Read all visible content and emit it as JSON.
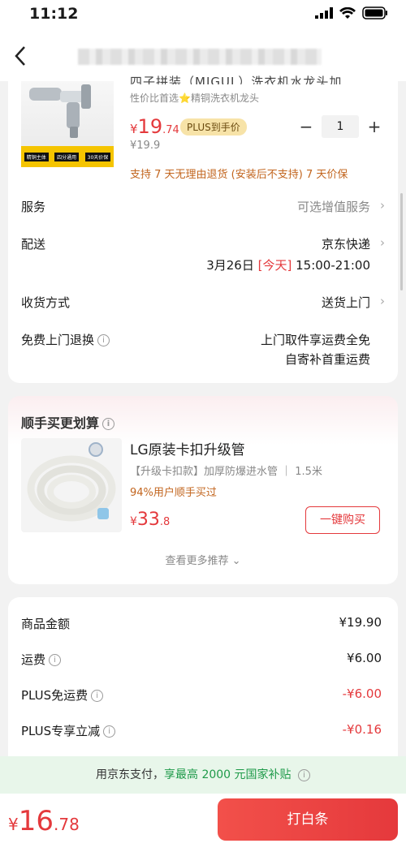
{
  "status": {
    "time": "11:12"
  },
  "product": {
    "name_cut": "四子拼装（MIGUL）洗衣机水龙头加…",
    "subtitle": "性价比首选⭐精铜洗衣机龙头",
    "price_yen": "¥",
    "price_int": "19",
    "price_dec": ".74",
    "plus_badge": "PLUS到手价",
    "orig_price": "¥19.9",
    "quantity": "1",
    "minus": "−",
    "plus": "+",
    "return_policy": "支持 7 天无理由退货 (安装后不支持)  7 天价保",
    "image_tags": [
      "精铜主体",
      "四分通用",
      "30天价保"
    ]
  },
  "service": {
    "label": "服务",
    "value": "可选增值服务"
  },
  "delivery": {
    "label": "配送",
    "carrier": "京东快递",
    "date": "3月26日",
    "today": "[今天]",
    "time": "15:00-21:00"
  },
  "receive": {
    "label": "收货方式",
    "value": "送货上门"
  },
  "free_return": {
    "label": "免费上门退换",
    "line1": "上门取件享运费全免",
    "line2": "自寄补首重运费"
  },
  "recommend": {
    "title": "顺手买更划算",
    "name": "LG原装卡扣升级管",
    "spec": "【升级卡扣款】加厚防爆进水管  ｜ 1.5米",
    "stat": "94%用户顺手买过",
    "price_yen": "¥",
    "price_int": "33",
    "price_dec": ".8",
    "buy_label": "一键购买",
    "more": "查看更多推荐"
  },
  "summary": {
    "goods": {
      "label": "商品金额",
      "value": "¥19.90"
    },
    "freight": {
      "label": "运费",
      "value": "¥6.00"
    },
    "plus_free": {
      "label": "PLUS免运费",
      "value": "-¥6.00"
    },
    "plus_cut": {
      "label": "PLUS专享立减",
      "value": "-¥0.16"
    }
  },
  "subsidy": {
    "prefix": "用京东支付，",
    "highlight": "享最高 2000 元国家补贴"
  },
  "bottom": {
    "total_yen": "¥",
    "total_int": "16",
    "total_dec": ".78",
    "pay_label": "打白条"
  },
  "colors": {
    "accent_red": "#e4393c",
    "orange": "#c2651e",
    "green": "#1e9a49"
  }
}
